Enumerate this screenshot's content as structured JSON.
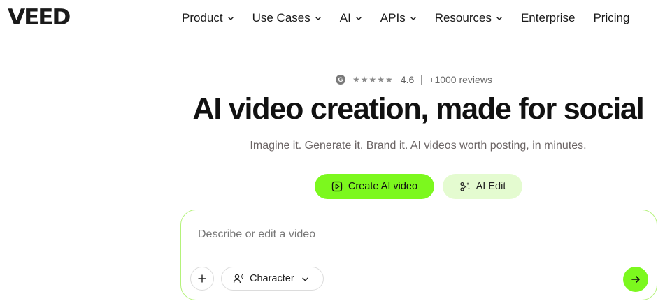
{
  "header": {
    "logo": "VEED",
    "nav": [
      {
        "label": "Product",
        "has_dropdown": true
      },
      {
        "label": "Use Cases",
        "has_dropdown": true
      },
      {
        "label": "AI",
        "has_dropdown": true
      },
      {
        "label": "APIs",
        "has_dropdown": true
      },
      {
        "label": "Resources",
        "has_dropdown": true
      },
      {
        "label": "Enterprise",
        "has_dropdown": false
      },
      {
        "label": "Pricing",
        "has_dropdown": false
      }
    ]
  },
  "rating": {
    "icon": "google-g-icon",
    "stars": "★★★★★",
    "stars_value": 4.5,
    "score": "4.6",
    "reviews": "+1000 reviews"
  },
  "hero": {
    "title": "AI video creation, made for social",
    "subtitle": "Imagine it. Generate it. Brand it. AI videos worth posting, in minutes."
  },
  "actions": {
    "create_label": "Create AI video",
    "create_icon": "play-square-icon",
    "edit_label": "AI Edit",
    "edit_icon": "sparkle-scissors-icon"
  },
  "prompt": {
    "placeholder": "Describe or edit a video",
    "value": "",
    "character_label": "Character"
  },
  "colors": {
    "accent": "#7cf81e",
    "accent_soft": "#e4fbd0",
    "border_accent": "#b4f27a"
  }
}
